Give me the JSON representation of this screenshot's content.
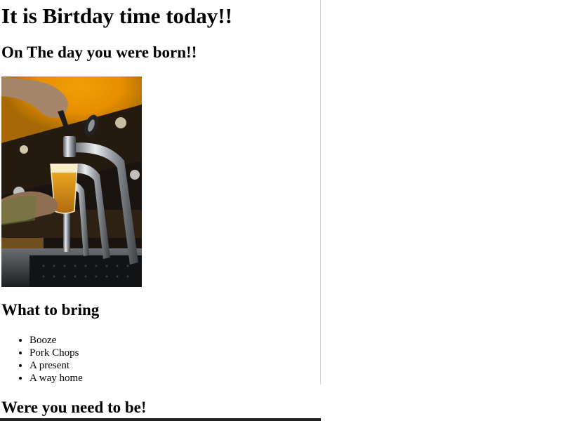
{
  "page": {
    "title": "It is Birtday time today!!",
    "subtitle": "On The day you were born!!",
    "image": {
      "alt": "Bartender pouring beer from a tap",
      "icon": "beer-tap-photo",
      "colors": {
        "background_glow": "#f2a000",
        "dark": "#1a1410",
        "beer": "#e0a020",
        "chrome": "#c8ccd0"
      }
    },
    "bring_heading": "What to bring",
    "bring_items": [
      "Booze",
      "Pork Chops",
      "A present",
      "A way home"
    ],
    "where_heading": "Were you need to be!"
  }
}
